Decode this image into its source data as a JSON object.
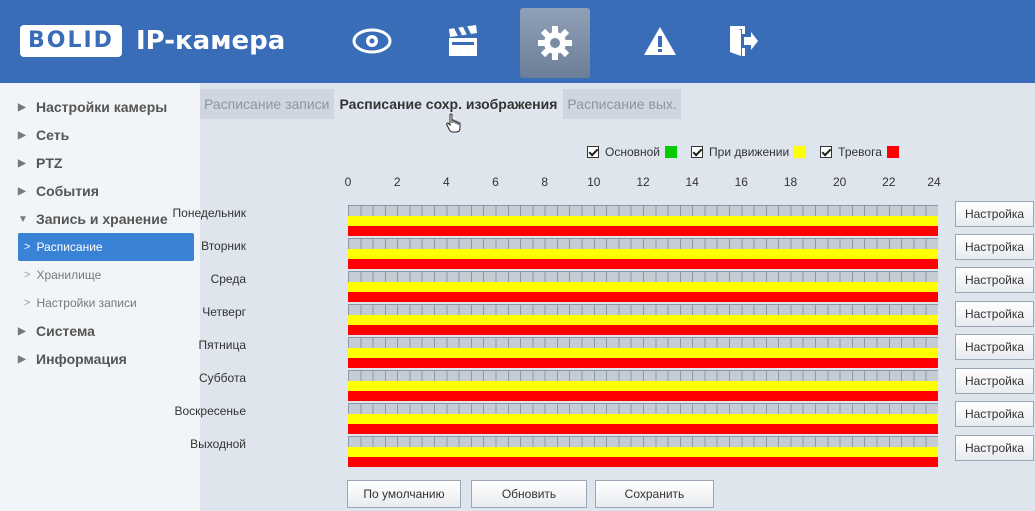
{
  "header": {
    "logo": "BOLID",
    "product": "IP-камера",
    "nav_icons": [
      "eye-icon",
      "clapperboard-icon",
      "gear-icon",
      "warning-icon",
      "exit-icon"
    ]
  },
  "sidebar": {
    "items": [
      {
        "label": "Настройки камеры",
        "expanded": false
      },
      {
        "label": "Сеть",
        "expanded": false
      },
      {
        "label": "PTZ",
        "expanded": false
      },
      {
        "label": "События",
        "expanded": false
      },
      {
        "label": "Запись и хранение",
        "expanded": true
      },
      {
        "label": "Система",
        "expanded": false
      },
      {
        "label": "Информация",
        "expanded": false
      }
    ],
    "subitems": [
      {
        "label": "Расписание",
        "active": true
      },
      {
        "label": "Хранилище",
        "active": false
      },
      {
        "label": "Настройки записи",
        "active": false
      }
    ]
  },
  "tabs": [
    {
      "label": "Расписание записи",
      "active": false
    },
    {
      "label": "Расписание сохр. изображения",
      "active": true
    },
    {
      "label": "Расписание вых.",
      "active": false
    }
  ],
  "legend": [
    {
      "label": "Основной",
      "color": "#00cc00",
      "checked": true
    },
    {
      "label": "При движении",
      "color": "#ffff00",
      "checked": true
    },
    {
      "label": "Тревога",
      "color": "#ff0000",
      "checked": true
    }
  ],
  "hours": [
    "0",
    "2",
    "4",
    "6",
    "8",
    "10",
    "12",
    "14",
    "16",
    "18",
    "20",
    "22",
    "24"
  ],
  "days": [
    "Понедельник",
    "Вторник",
    "Среда",
    "Четверг",
    "Пятница",
    "Суббота",
    "Воскресенье",
    "Выходной"
  ],
  "setup_label": "Настройка",
  "buttons": {
    "default": "По умолчанию",
    "refresh": "Обновить",
    "save": "Сохранить"
  },
  "colors": {
    "header": "#3a6db8",
    "accent": "#3a82d6",
    "motion": "#ffff00",
    "alarm": "#ff0000"
  }
}
